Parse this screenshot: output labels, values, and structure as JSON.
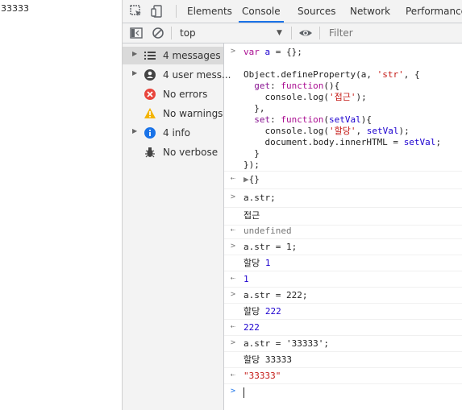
{
  "page": {
    "body_text": "33333"
  },
  "devtools": {
    "tabs": [
      "Elements",
      "Console",
      "Sources",
      "Network",
      "Performance"
    ],
    "active_tab": "Console",
    "context": "top",
    "filter_placeholder": "Filter"
  },
  "sidebar": {
    "items": [
      {
        "label": "4 messages",
        "icon": "list-icon",
        "selected": true
      },
      {
        "label": "4 user mess...",
        "icon": "user-icon",
        "selected": false
      },
      {
        "label": "No errors",
        "icon": "error-icon",
        "selected": false
      },
      {
        "label": "No warnings",
        "icon": "warning-icon",
        "selected": false
      },
      {
        "label": "4 info",
        "icon": "info-icon",
        "selected": false
      },
      {
        "label": "No verbose",
        "icon": "bug-icon",
        "selected": false
      }
    ]
  },
  "console": {
    "code_block": {
      "line1": "var a = {};",
      "line3": "Object.defineProperty(a, 'str', {",
      "line4": "  get: function(){",
      "line5": "    console.log('접근');",
      "line6": "  },",
      "line7": "  set: function(setVal){",
      "line8": "    console.log('할당', setVal);",
      "line9": "    document.body.innerHTML = setVal;",
      "line10": "  }",
      "line11": "});"
    },
    "result_object": "{}",
    "entries": [
      {
        "type": "input",
        "text": "a.str;"
      },
      {
        "type": "log",
        "text": "접근"
      },
      {
        "type": "result",
        "text": "undefined"
      },
      {
        "type": "input",
        "text": "a.str = 1;"
      },
      {
        "type": "log",
        "text": "할당",
        "value": "1"
      },
      {
        "type": "result",
        "text": "1"
      },
      {
        "type": "input",
        "text": "a.str = 222;"
      },
      {
        "type": "log",
        "text": "할당",
        "value": "222"
      },
      {
        "type": "result",
        "text": "222"
      },
      {
        "type": "input",
        "text": "a.str = '33333';"
      },
      {
        "type": "log",
        "text": "할당",
        "value": "33333"
      },
      {
        "type": "result",
        "text": "\"33333\""
      }
    ]
  },
  "colors": {
    "accent": "#1a73e8",
    "string": "#c41a16",
    "number": "#1c00cf",
    "keyword": "#aa0d91"
  }
}
